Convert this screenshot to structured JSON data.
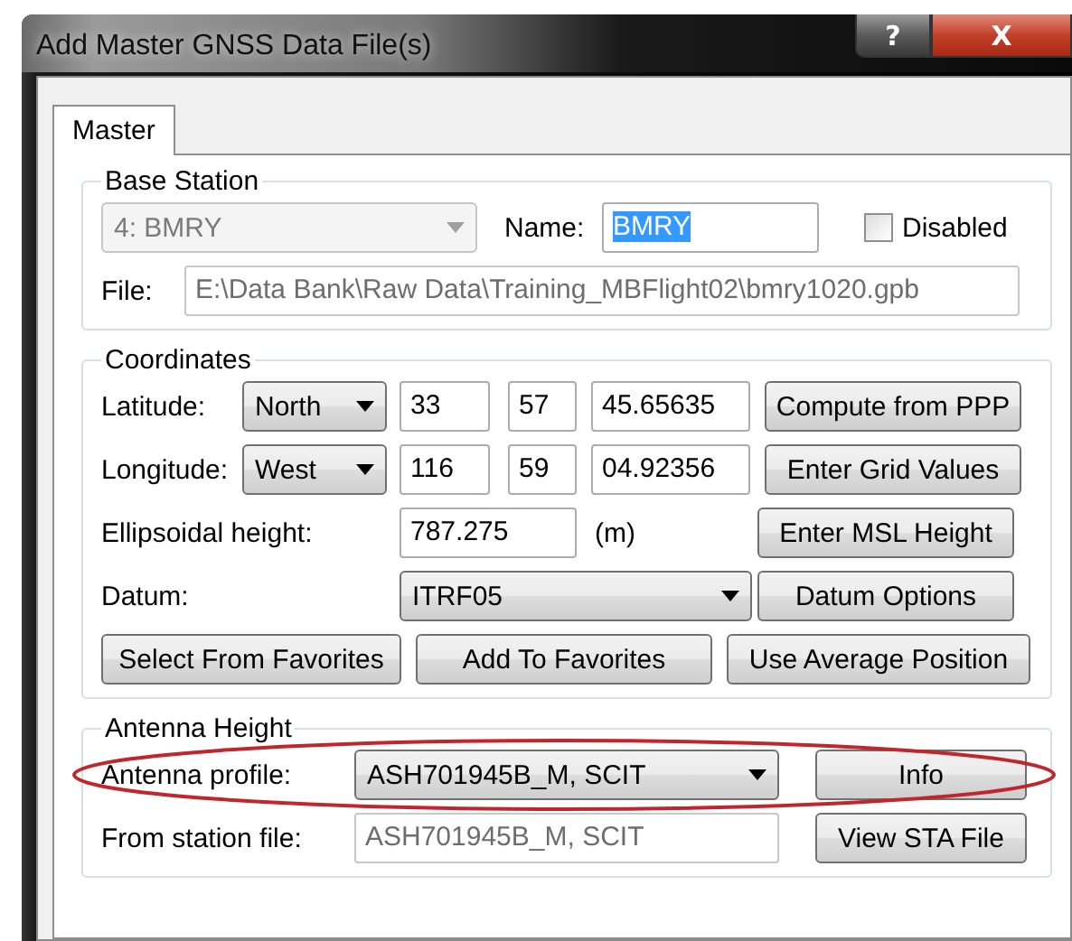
{
  "window": {
    "title": "Add Master GNSS Data File(s)",
    "help_label": "?",
    "close_label": "X"
  },
  "tabs": [
    {
      "label": "Master",
      "selected": true
    }
  ],
  "base_station": {
    "title": "Base Station",
    "station": {
      "value": "4: BMRY",
      "disabled": true
    },
    "name_label": "Name:",
    "name": {
      "value": "BMRY",
      "text_selected": true
    },
    "disabled_checkbox": {
      "label": "Disabled",
      "checked": false
    },
    "file_label": "File:",
    "file": {
      "value": "E:\\Data Bank\\Raw Data\\Training_MBFlight02\\bmry1020.gpb",
      "disabled": true
    }
  },
  "coordinates": {
    "title": "Coordinates",
    "rows": [
      {
        "label": "Latitude:",
        "hemisphere": "North",
        "degrees": "33",
        "minutes": "57",
        "seconds": "45.65635",
        "button": "Compute from PPP"
      },
      {
        "label": "Longitude:",
        "hemisphere": "West",
        "degrees": "116",
        "minutes": "59",
        "seconds": "04.92356",
        "button": "Enter Grid Values"
      }
    ],
    "ellipsoidal": {
      "label": "Ellipsoidal height:",
      "value": "787.275",
      "unit": "(m)",
      "button": "Enter MSL Height"
    },
    "datum": {
      "label": "Datum:",
      "value": "ITRF05",
      "button": "Datum Options"
    },
    "buttons": [
      "Select From Favorites",
      "Add To Favorites",
      "Use Average Position"
    ]
  },
  "antenna": {
    "title": "Antenna Height",
    "profile": {
      "label": "Antenna profile:",
      "value": "ASH701945B_M, SCIT",
      "highlighted": true,
      "button": "Info"
    },
    "station_file": {
      "label": "From station file:",
      "value": "ASH701945B_M, SCIT",
      "disabled": true,
      "button": "View STA File"
    }
  }
}
